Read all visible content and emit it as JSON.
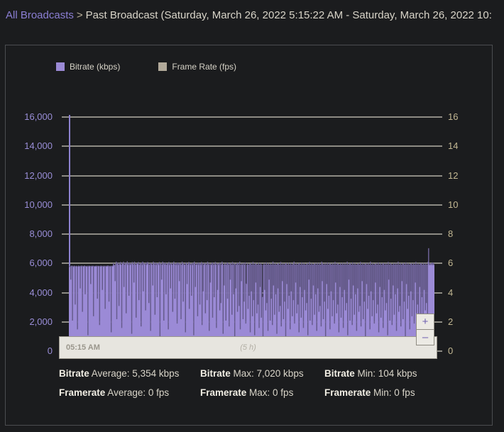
{
  "breadcrumb": {
    "link_label": "All Broadcasts",
    "separator": ">",
    "current_label": "Past Broadcast (Saturday, March 26, 2022 5:15:22 AM - Saturday, March 26, 2022 10:"
  },
  "legend": {
    "items": [
      {
        "label": "Bitrate (kbps)",
        "color": "#9b8ad6",
        "name": "bitrate"
      },
      {
        "label": "Frame Rate (fps)",
        "color": "#b2aa9a",
        "name": "frame-rate"
      }
    ]
  },
  "zoom_controls": {
    "zoom_in_label": "+",
    "zoom_out_label": "–"
  },
  "scrubber": {
    "start_time": "05:15 AM",
    "duration": "(5 h)"
  },
  "stats": {
    "rows": [
      [
        {
          "name": "Bitrate",
          "label": "Average: 5,354 kbps"
        },
        {
          "name": "Bitrate",
          "label": "Max: 7,020 kbps"
        },
        {
          "name": "Bitrate",
          "label": "Min: 104 kbps"
        }
      ],
      [
        {
          "name": "Framerate",
          "label": "Average: 0 fps"
        },
        {
          "name": "Framerate",
          "label": "Max: 0 fps"
        },
        {
          "name": "Framerate",
          "label": "Min: 0 fps"
        }
      ]
    ]
  },
  "chart_data": {
    "type": "area",
    "title": "",
    "xlabel": "",
    "grid": true,
    "legend_position": "top-left",
    "axes": {
      "left": {
        "label": "Bitrate (kbps)",
        "color": "#9a8ed8",
        "ylim": [
          0,
          16000
        ],
        "ticks": [
          0,
          2000,
          4000,
          6000,
          8000,
          10000,
          12000,
          14000,
          16000
        ],
        "tick_labels": [
          "0",
          "2,000",
          "4,000",
          "6,000",
          "8,000",
          "10,000",
          "12,000",
          "14,000",
          "16,000"
        ]
      },
      "right": {
        "label": "Frame Rate (fps)",
        "color": "#c3b893",
        "ylim": [
          0,
          16
        ],
        "ticks": [
          0,
          2,
          4,
          6,
          8,
          10,
          12,
          14,
          16
        ],
        "tick_labels": [
          "0",
          "2",
          "4",
          "6",
          "8",
          "10",
          "12",
          "14",
          "16"
        ]
      },
      "x": {
        "start_time": "05:15 AM",
        "duration_hours": 5
      }
    },
    "series": [
      {
        "name": "Bitrate (kbps)",
        "color": "#9b8ad6",
        "unit": "kbps",
        "axis": "left",
        "average": 5354,
        "max": 7020,
        "min": 104,
        "values": [
          5760,
          5820,
          5790,
          4900,
          5810,
          5840,
          2100,
          5800,
          5770,
          5830,
          5810,
          3200,
          5790,
          5820,
          5800,
          1500,
          5780,
          5830,
          5810,
          5790,
          4300,
          5820,
          5800,
          5830,
          2700,
          5810,
          5790,
          5820,
          5840,
          3900,
          5800,
          5810,
          5780,
          5820,
          1100,
          5790,
          5830,
          5810,
          5800,
          4600,
          5820,
          5790,
          5810,
          5830,
          2400,
          5800,
          5780,
          5820,
          5810,
          5790,
          5830,
          3600,
          5800,
          5820,
          5810,
          1800,
          5790,
          5830,
          5800,
          5820,
          4200,
          5810,
          5780,
          5830,
          5800,
          2900,
          5820,
          5790,
          5810,
          5840,
          5800,
          5830,
          3400,
          5810,
          5790,
          5820,
          1300,
          5800,
          5830,
          5810,
          6000,
          5900,
          5870,
          4800,
          5950,
          6100,
          2200,
          5980,
          6050,
          5900,
          3100,
          6000,
          5950,
          6080,
          5900,
          1600,
          6020,
          5980,
          6100,
          4400,
          5900,
          6050,
          5970,
          2600,
          6000,
          6120,
          5900,
          5980,
          3800,
          6050,
          5900,
          6000,
          5950,
          1200,
          6080,
          6000,
          5920,
          4700,
          6100,
          5980,
          5900,
          2300,
          6020,
          6000,
          5950,
          6080,
          3500,
          5900,
          6000,
          5970,
          1700,
          6050,
          5900,
          6100,
          4100,
          5980,
          6000,
          5930,
          2800,
          6050,
          5900,
          6000,
          6080,
          5950,
          3300,
          5900,
          6020,
          1400,
          6000,
          5970,
          5900,
          4500,
          6100,
          6000,
          5920,
          2500,
          6050,
          5900,
          6000,
          3700,
          5980,
          6000,
          5900,
          6080,
          1000,
          5950,
          6000,
          4900,
          5900,
          6100,
          5980,
          2100,
          6000,
          5930,
          6050,
          3900,
          5900,
          6000,
          5970,
          1500,
          6080,
          5900,
          6000,
          4300,
          5950,
          6020,
          5900,
          2700,
          6000,
          6100,
          5930,
          3600,
          5980,
          5900,
          6000,
          1900,
          6050,
          5900,
          6000,
          4800,
          5960,
          6000,
          2200,
          5900,
          6100,
          5980,
          3400,
          6000,
          5920,
          5900,
          1300,
          6050,
          6000,
          4600,
          5900,
          5970,
          6080,
          2900,
          6000,
          5900,
          5950,
          3800,
          6020,
          5900,
          6000,
          1100,
          6100,
          5980,
          4400,
          5900,
          6000,
          5930,
          2400,
          6050,
          5900,
          6000,
          3200,
          5970,
          5900,
          6080,
          1800,
          6000,
          4100,
          5900,
          6020,
          5950,
          2600,
          6000,
          5900,
          3500,
          6100,
          5980,
          5900,
          1400,
          6000,
          4700,
          5930,
          5900,
          6050,
          2300,
          6000,
          5900,
          3700,
          5970,
          6080,
          5900,
          1600,
          6000,
          4200,
          5950,
          5900,
          6020,
          2800,
          6000,
          3300,
          5900,
          6100,
          5980,
          1200,
          5900,
          4500,
          6000,
          5930,
          2100,
          5900,
          6050,
          3600,
          6000,
          5900,
          1700,
          5970,
          4900,
          6000,
          5900,
          2500,
          6080,
          5900,
          3900,
          6000,
          1000,
          5950,
          4300,
          5900,
          6020,
          2700,
          6000,
          5900,
          3100,
          6100,
          1500,
          5900,
          4800,
          5980,
          5900,
          2200,
          6000,
          3400,
          5900,
          6050,
          1900,
          4600,
          5900,
          6000,
          2900,
          5900,
          3800,
          5970,
          1300,
          6000,
          4100,
          5900,
          2400,
          6080,
          3500,
          5900,
          1100,
          6000,
          4700,
          5950,
          2600,
          5900,
          3200,
          6020,
          1600,
          5900,
          4400,
          6000,
          2300,
          5900,
          3700,
          104,
          5900,
          6000,
          4200,
          5900,
          2800,
          6050,
          3300,
          5900,
          1400,
          6000,
          4900,
          5900,
          2100,
          5970,
          3600,
          5900,
          1800,
          6100,
          4500,
          5900,
          2500,
          6000,
          3900,
          5900,
          1200,
          5950,
          4300,
          6000,
          2700,
          5900,
          3100,
          6080,
          1700,
          5900,
          4800,
          6000,
          2200,
          5900,
          3400,
          5980,
          1000,
          6000,
          4600,
          5900,
          2900,
          6020,
          3800,
          5900,
          1500,
          6000,
          4100,
          5900,
          2400,
          5950,
          3500,
          6100,
          1900,
          5900,
          4700,
          6000,
          2600,
          5900,
          3200,
          5970,
          1300,
          6000,
          4400,
          5900,
          2300,
          6050,
          3700,
          5900,
          1600,
          6000,
          4200,
          5900,
          2800,
          5930,
          3300,
          6000,
          1100,
          5900,
          4900,
          6080,
          2100,
          5900,
          3600,
          6000,
          1800,
          5900,
          4500,
          5950,
          2500,
          6000,
          3900,
          5900,
          1400,
          6020,
          4300,
          5900,
          2700,
          6000,
          3100,
          5900,
          1700,
          6100,
          4800,
          5980,
          2200,
          5900,
          3400,
          6000,
          1000,
          5900,
          4600,
          6050,
          2900,
          5900,
          3800,
          6000,
          1500,
          5970,
          4100,
          5900,
          2400,
          6000,
          3500,
          5900,
          1900,
          6080,
          4700,
          5900,
          2600,
          6000,
          3200,
          5950,
          1300,
          5900,
          4400,
          6000,
          2300,
          5900,
          3700,
          6020,
          1600,
          5900,
          4200,
          6000,
          2800,
          5900,
          3300,
          6100,
          1100,
          5900,
          4900,
          5980,
          2100,
          6000,
          3600,
          5900,
          1800,
          6050,
          4500,
          5900,
          2500,
          6000,
          3900,
          5900,
          1400,
          5930,
          4300,
          6000,
          2700,
          5900,
          3100,
          6080,
          1700,
          5900,
          4800,
          6000,
          2200,
          5900,
          3400,
          5970,
          1000,
          6000,
          4600,
          5900,
          2900,
          6020,
          3800,
          5900,
          1500,
          6100,
          4100,
          5900,
          2400,
          6000,
          3500,
          5900,
          1900,
          5950,
          4700,
          6000,
          2600,
          5900,
          3200,
          6050,
          1300,
          5900,
          4400,
          6000,
          2300,
          5900,
          3700,
          5980,
          1600,
          6000,
          4200,
          5900,
          2800,
          6000,
          3300,
          5900,
          1100,
          6080,
          4900,
          5900,
          2100,
          6000,
          3600,
          5930,
          1800,
          5900,
          4500,
          6000,
          2500,
          5900,
          3900,
          6020,
          1400,
          5900,
          4300,
          6100,
          2700,
          5900,
          3100,
          6000,
          1700,
          5900,
          4800,
          5970,
          2200,
          6000,
          3400,
          5900,
          1000,
          6050,
          4600,
          5900,
          2900,
          6000,
          3800,
          5900,
          1500,
          5950,
          4100,
          6000,
          2400,
          5900,
          3500,
          6000,
          1900,
          5900,
          4700,
          6080,
          2600,
          5900,
          3200,
          6000,
          1300,
          5900,
          4400,
          5980,
          2300,
          6000,
          3700,
          5900,
          1600,
          6020,
          4200,
          5900,
          2800,
          6000,
          3300,
          5900,
          1100,
          6100,
          7020,
          5900,
          6000,
          5900,
          5950,
          6000,
          5900,
          6050,
          5900,
          6000,
          5900
        ]
      },
      {
        "name": "Frame Rate (fps)",
        "color": "#b2aa9a",
        "unit": "fps",
        "axis": "right",
        "average": 0,
        "max": 0,
        "min": 0,
        "values": []
      }
    ]
  }
}
